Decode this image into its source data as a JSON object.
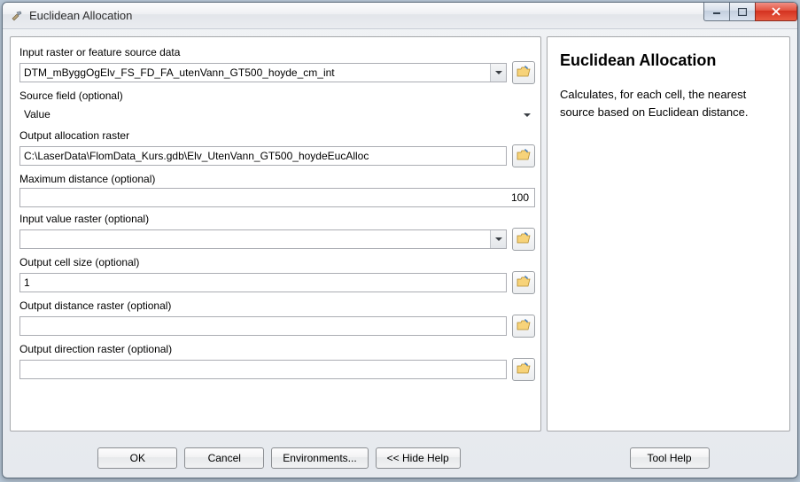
{
  "window": {
    "title": "Euclidean Allocation"
  },
  "form": {
    "input_raster_label": "Input raster or feature source data",
    "input_raster_value": "DTM_mByggOgElv_FS_FD_FA_utenVann_GT500_hoyde_cm_int",
    "source_field_label": "Source field (optional)",
    "source_field_value": "Value",
    "output_alloc_label": "Output allocation raster",
    "output_alloc_value": "C:\\LaserData\\FlomData_Kurs.gdb\\Elv_UtenVann_GT500_hoydeEucAlloc",
    "max_distance_label": "Maximum distance (optional)",
    "max_distance_value": "100",
    "input_value_raster_label": "Input value raster (optional)",
    "input_value_raster_value": "",
    "output_cell_size_label": "Output cell size (optional)",
    "output_cell_size_value": "1",
    "output_distance_label": "Output distance raster (optional)",
    "output_distance_value": "",
    "output_direction_label": "Output direction raster (optional)",
    "output_direction_value": ""
  },
  "help": {
    "title": "Euclidean Allocation",
    "text": "Calculates, for each cell, the nearest source based on Euclidean distance."
  },
  "buttons": {
    "ok": "OK",
    "cancel": "Cancel",
    "environments": "Environments...",
    "hide_help": "<< Hide Help",
    "tool_help": "Tool Help"
  }
}
